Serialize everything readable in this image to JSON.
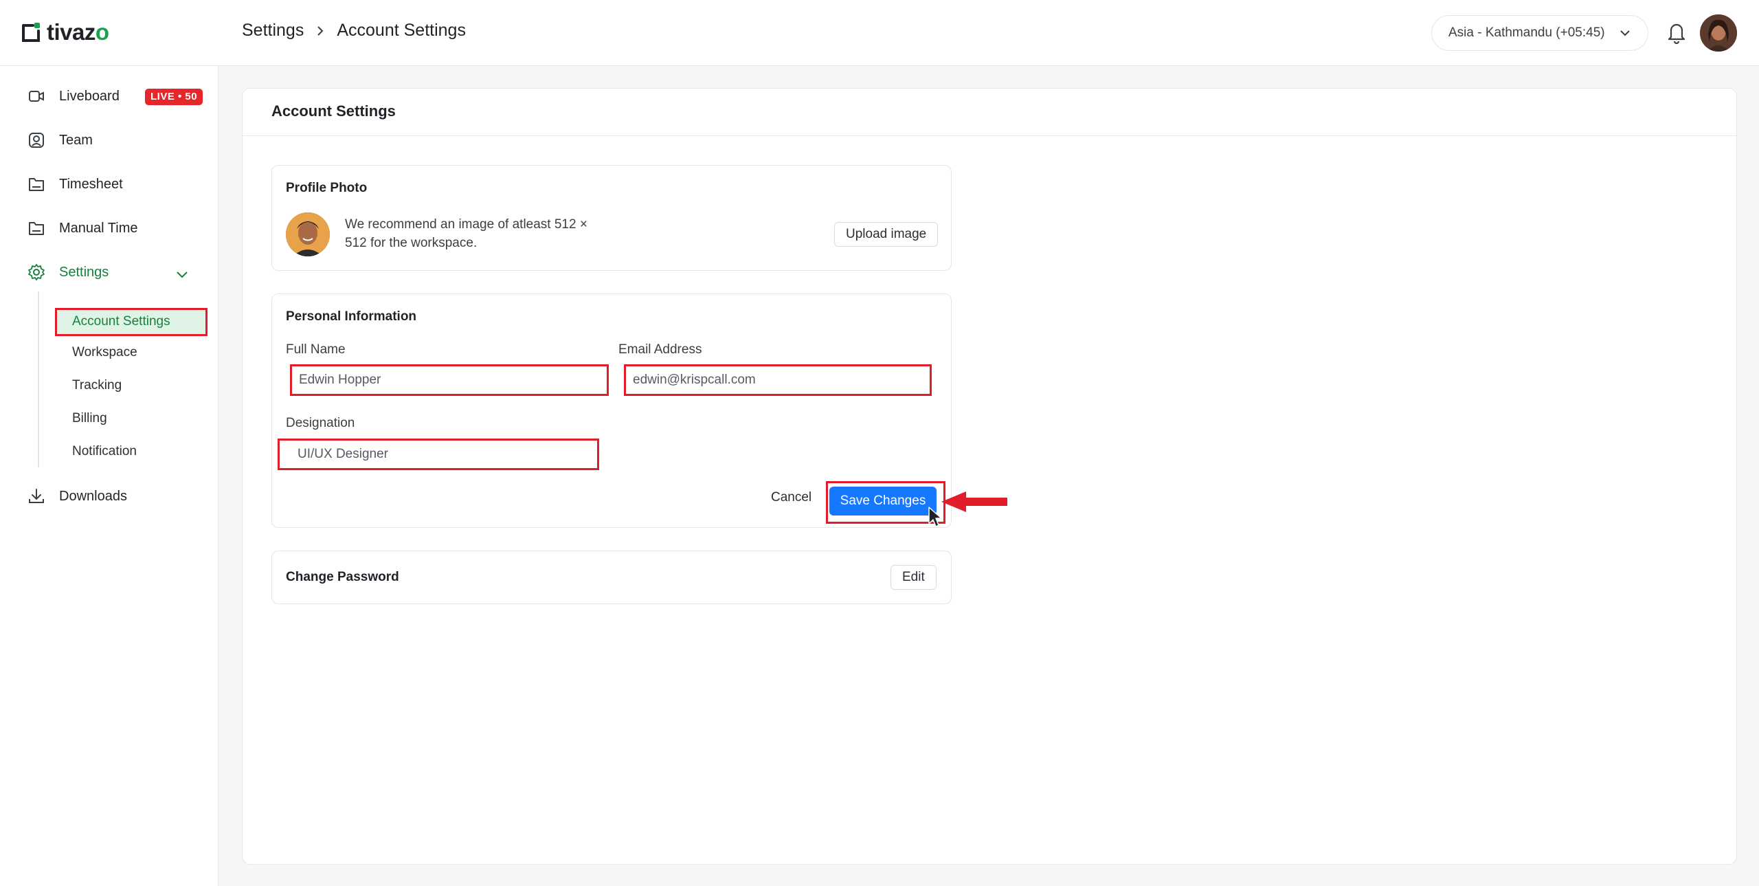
{
  "header": {
    "logo_prefix": "tivaz",
    "logo_suffix": "o",
    "breadcrumb": [
      "Settings",
      "Account Settings"
    ],
    "timezone": "Asia - Kathmandu (+05:45)"
  },
  "sidebar": {
    "items": [
      {
        "label": "Liveboard",
        "badge": "LIVE • 50"
      },
      {
        "label": "Team"
      },
      {
        "label": "Timesheet"
      },
      {
        "label": "Manual Time"
      },
      {
        "label": "Settings"
      },
      {
        "label": "Downloads"
      }
    ],
    "settings_subitems": [
      "Account Settings",
      "Workspace",
      "Tracking",
      "Billing",
      "Notification"
    ]
  },
  "main": {
    "title": "Account Settings",
    "profile_photo": {
      "title": "Profile Photo",
      "recommendation": "We recommend an image of atleast 512 × 512 for the workspace.",
      "upload_label": "Upload image"
    },
    "personal_info": {
      "title": "Personal Information",
      "full_name_label": "Full Name",
      "full_name_value": "Edwin Hopper",
      "email_label": "Email Address",
      "email_value": "edwin@krispcall.com",
      "designation_label": "Designation",
      "designation_value": "UI/UX Designer",
      "cancel_label": "Cancel",
      "save_label": "Save Changes"
    },
    "change_password": {
      "title": "Change Password",
      "edit_label": "Edit"
    }
  },
  "colors": {
    "brand_green": "#16a34a",
    "primary_blue": "#1677ff",
    "annotation_red": "#e11d2a",
    "live_red": "#e5262b"
  }
}
